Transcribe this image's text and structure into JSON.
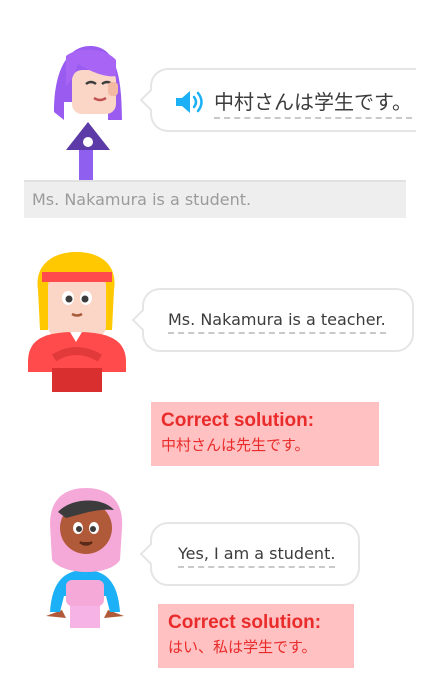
{
  "exercise1": {
    "prompt": "中村さんは学生です。",
    "translation": "Ms. Nakamura is a student."
  },
  "exercise2": {
    "answer": "Ms. Nakamura is a teacher.",
    "solution_title": "Correct solution:",
    "solution_text": "中村さんは先生です。"
  },
  "exercise3": {
    "answer": "Yes, I am a student.",
    "solution_title": "Correct solution:",
    "solution_text": "はい、私は学生です。"
  },
  "icons": {
    "speaker": "speaker-icon",
    "char1": "lily-character",
    "char2": "vikram-character",
    "char3": "zari-character"
  },
  "colors": {
    "error_text": "#ea2b2b",
    "error_bg": "#ffc1c1",
    "speaker_blue": "#1cb0f6"
  }
}
